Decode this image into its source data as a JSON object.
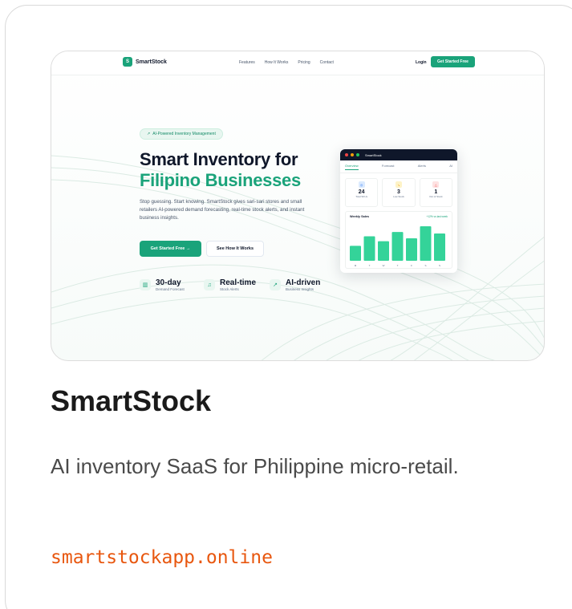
{
  "card": {
    "title": "SmartStock",
    "description": "AI inventory SaaS for Philippine micro-retail.",
    "url": "smartstockapp.online",
    "url_color": "#e8570f"
  },
  "preview": {
    "brand": {
      "mark": "S",
      "name": "SmartStock",
      "accent": "#1aa37a"
    },
    "nav": [
      "Features",
      "How It Works",
      "Pricing",
      "Contact"
    ],
    "login": "Login",
    "nav_cta": "Get Started Free",
    "pill": "AI-Powered Inventory Management",
    "headline_1": "Smart Inventory for",
    "headline_2": "Filipino Businesses",
    "subtext": "Stop guessing. Start knowing. SmartStock gives sari-sari stores and small retailers AI-powered demand forecasting, real-time stock alerts, and instant business insights.",
    "primary_button": "Get Started Free →",
    "secondary_button": "See How It Works",
    "stats": [
      {
        "icon": "bar-chart-icon",
        "value": "30-day",
        "label": "Demand Forecast"
      },
      {
        "icon": "bell-icon",
        "value": "Real-time",
        "label": "Stock Alerts"
      },
      {
        "icon": "trend-up-icon",
        "value": "AI-driven",
        "label": "Business Insights"
      }
    ],
    "dashboard": {
      "app_title": "SmartStock",
      "tabs": [
        "Overview",
        "Forecast",
        "Alerts",
        "AI"
      ],
      "kpis": [
        {
          "value": "24",
          "label": "Total SKUs",
          "color": "#3b82f6"
        },
        {
          "value": "3",
          "label": "Low Stock",
          "color": "#f59e0b"
        },
        {
          "value": "1",
          "label": "Out of Stock",
          "color": "#ef4444"
        }
      ],
      "weekly_title": "Weekly Sales",
      "weekly_delta": "+12% vs last week",
      "days": [
        "M",
        "T",
        "W",
        "T",
        "F",
        "S",
        "S"
      ],
      "sales_relative": [
        0.52,
        0.85,
        0.68,
        1.0,
        0.78,
        1.2,
        0.95
      ]
    }
  }
}
